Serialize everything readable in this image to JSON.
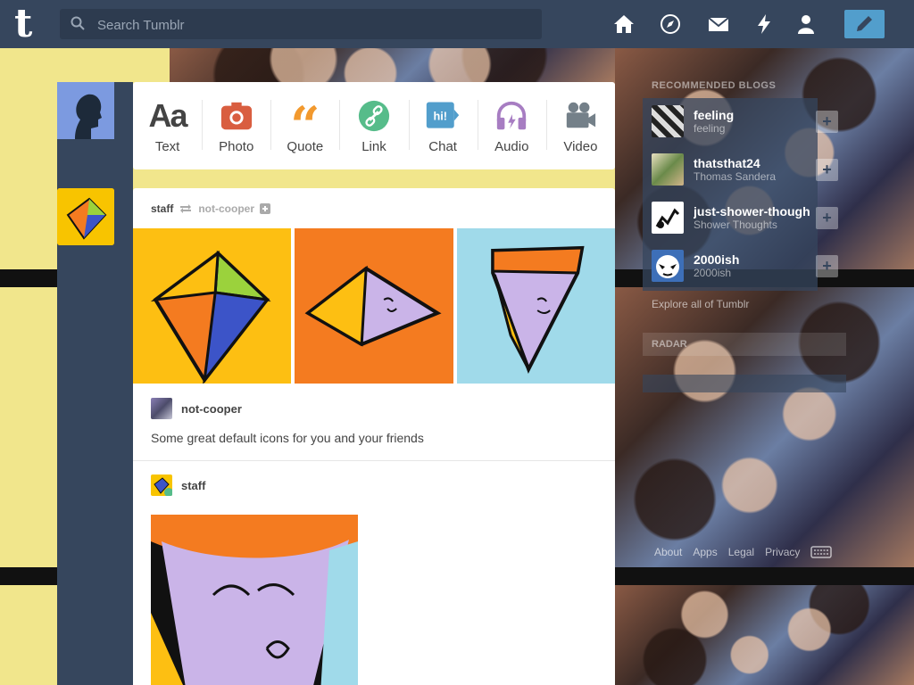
{
  "header": {
    "logo": "t",
    "search_placeholder": "Search Tumblr",
    "nav": [
      "home-icon",
      "explore-icon",
      "inbox-icon",
      "activity-icon",
      "account-icon"
    ],
    "compose": "pencil-icon"
  },
  "post_types": [
    {
      "label": "Text",
      "icon": "text-icon",
      "color": "#444444"
    },
    {
      "label": "Photo",
      "icon": "camera-icon",
      "color": "#d95e40"
    },
    {
      "label": "Quote",
      "icon": "quote-icon",
      "color": "#f2992e"
    },
    {
      "label": "Link",
      "icon": "link-icon",
      "color": "#56bc8a"
    },
    {
      "label": "Chat",
      "icon": "chat-icon",
      "color": "#529ecc"
    },
    {
      "label": "Audio",
      "icon": "headphones-icon",
      "color": "#a77dc2"
    },
    {
      "label": "Video",
      "icon": "video-icon",
      "color": "#748089"
    }
  ],
  "post": {
    "author": "staff",
    "reblogged_from": "not-cooper",
    "reblog_user": "not-cooper",
    "caption": "Some great default icons for you and your friends",
    "source_user": "staff"
  },
  "sidebar": {
    "heading": "RECOMMENDED BLOGS",
    "blogs": [
      {
        "name": "feeling",
        "sub": "feeling"
      },
      {
        "name": "thatsthat24",
        "sub": "Thomas Sandera"
      },
      {
        "name": "just-shower-thoughts",
        "sub": "Shower Thoughts"
      },
      {
        "name": "2000ish",
        "sub": "2000ish"
      }
    ],
    "explore": "Explore all of Tumblr",
    "radar": "RADAR"
  },
  "footer": {
    "links": [
      "About",
      "Apps",
      "Legal",
      "Privacy"
    ]
  }
}
